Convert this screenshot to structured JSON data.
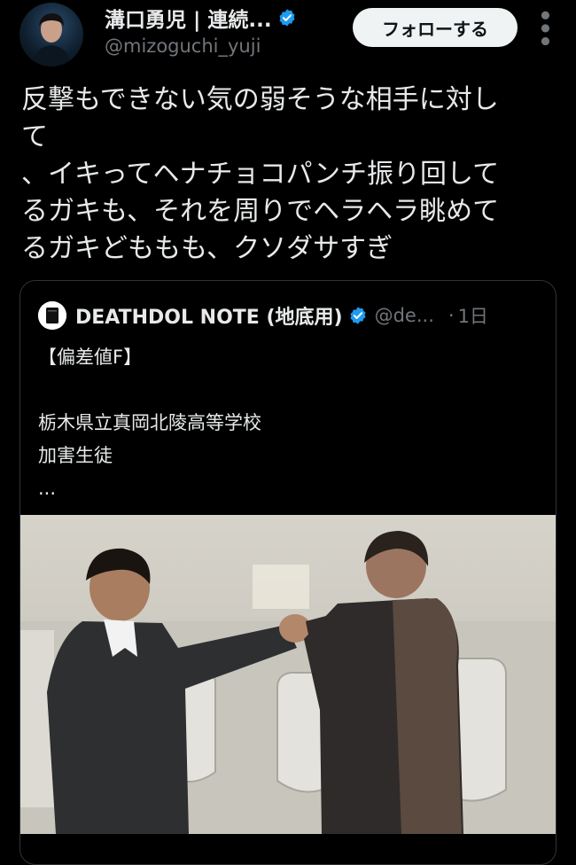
{
  "tweet": {
    "author_name": "溝口勇児 | 連続...",
    "author_handle": "@mizoguchi_yuji",
    "follow_label": "フォローする",
    "text": "反撃もできない気の弱そうな相手に対し\nて\n、イキってヘナチョコパンチ振り回して\nるガキも、それを周りでヘラヘラ眺めて\nるガキどももも、クソダサすぎ"
  },
  "quoted_tweet": {
    "author_name": "DEATHDOL NOTE (地底用)",
    "author_handle": "@de...",
    "time": "1日",
    "text": "【偏差値F】\n\n栃木県立真岡北陵高等学校\n加害生徒",
    "ellipsis": "..."
  },
  "colors": {
    "background": "#000000",
    "text": "#e7e9ea",
    "secondary_text": "#71767b",
    "verified_blue": "#1d9bf0",
    "follow_button_bg": "#eff3f4",
    "border": "#2f3336"
  },
  "icons": {
    "verified": "verified-badge-icon",
    "more": "more-vertical-icon"
  }
}
